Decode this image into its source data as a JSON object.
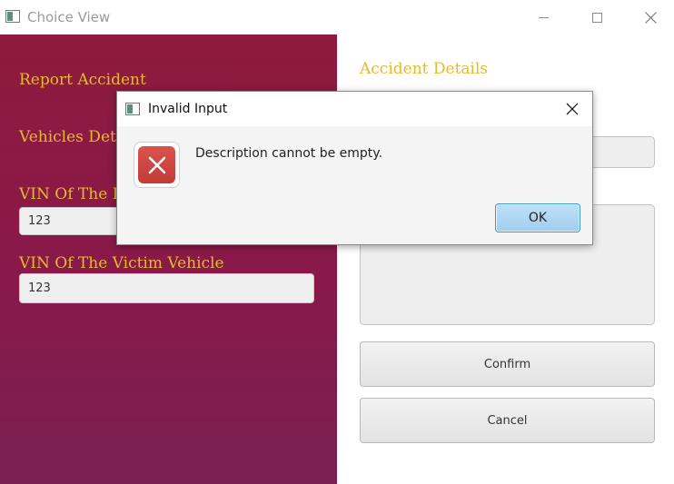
{
  "window": {
    "title": "Choice View"
  },
  "left": {
    "report_accident": "Report Accident",
    "vehicles_details": "Vehicles Deta",
    "vin_responsible_label": "VIN Of The Re",
    "vin_responsible_value": "123",
    "vin_victim_label": "VIN Of The Victim Vehicle",
    "vin_victim_value": "123"
  },
  "right": {
    "accident_details": "Accident Details",
    "confirm_label": "Confirm",
    "cancel_label": "Cancel"
  },
  "dialog": {
    "title": "Invalid Input",
    "message": "Description cannot be empty.",
    "ok_label": "OK"
  },
  "colors": {
    "accent_gold": "#e8b92f",
    "panel_crimson": "#8e1a3d",
    "error_red": "#c33a36",
    "ok_blue": "#3c97d6"
  }
}
